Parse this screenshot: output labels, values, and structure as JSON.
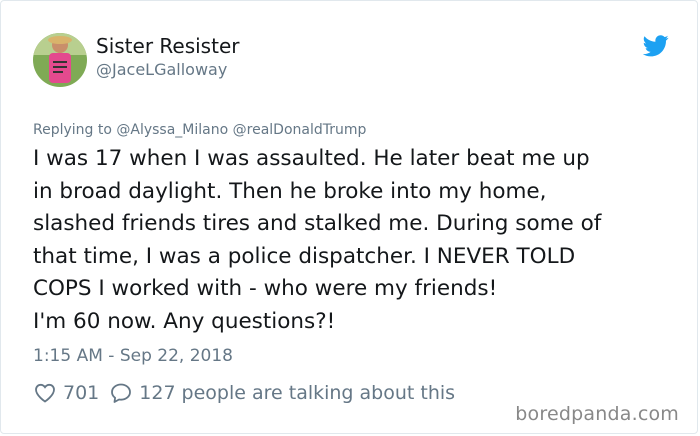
{
  "author": {
    "display_name": "Sister Resister",
    "handle": "@JaceLGalloway"
  },
  "reply_context": {
    "prefix": "Replying to",
    "mentions": [
      "@Alyssa_Milano",
      "@realDonaldTrump"
    ]
  },
  "tweet": {
    "lines": [
      "I was 17 when I was assaulted. He later beat me up",
      "in broad daylight. Then he broke into my home,",
      "slashed friends tires and stalked me. During some of",
      "that time, I was a police dispatcher. I NEVER TOLD",
      "COPS I worked with - who were my friends!",
      "I'm 60 now. Any questions?!"
    ],
    "timestamp": "1:15 AM - Sep 22, 2018"
  },
  "engagement": {
    "likes": "701",
    "replies": "127",
    "replies_suffix": "people are talking about this"
  },
  "watermark": "boredpanda.com",
  "icons": {
    "platform": "twitter-bird-icon",
    "like": "heart-icon",
    "reply": "speech-bubble-icon"
  },
  "colors": {
    "brand": "#1da1f2",
    "text": "#14171a",
    "muted": "#657786"
  }
}
